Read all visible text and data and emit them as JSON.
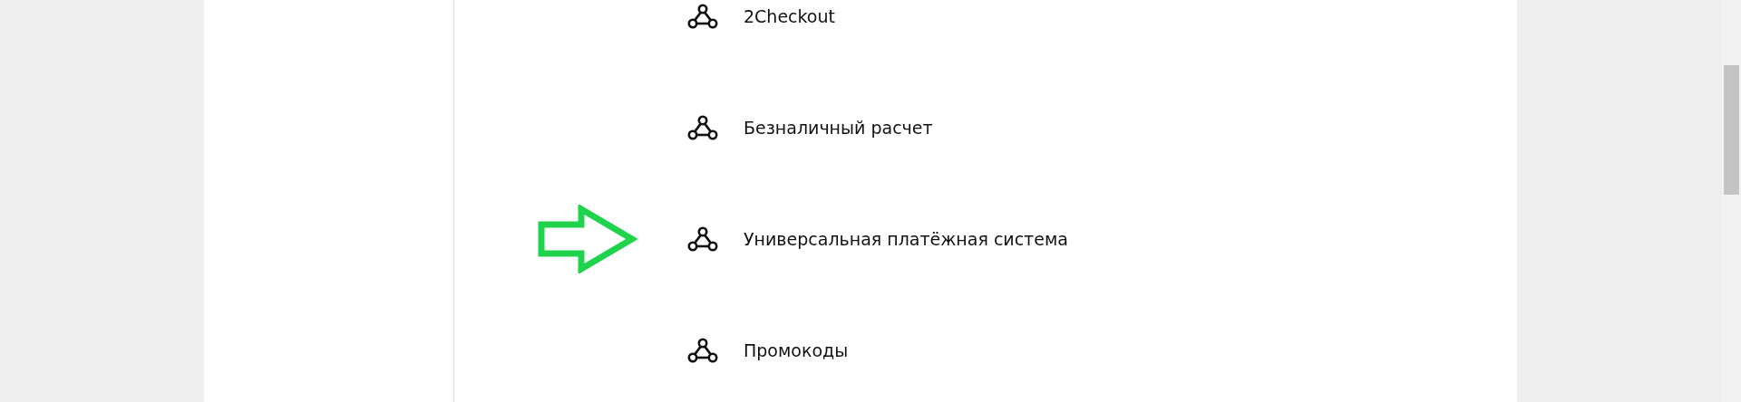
{
  "items": [
    {
      "label": "2Checkout",
      "highlighted": false
    },
    {
      "label": "Безналичный расчет",
      "highlighted": false
    },
    {
      "label": "Универсальная платёжная система",
      "highlighted": true
    },
    {
      "label": "Промокоды",
      "highlighted": false
    }
  ]
}
